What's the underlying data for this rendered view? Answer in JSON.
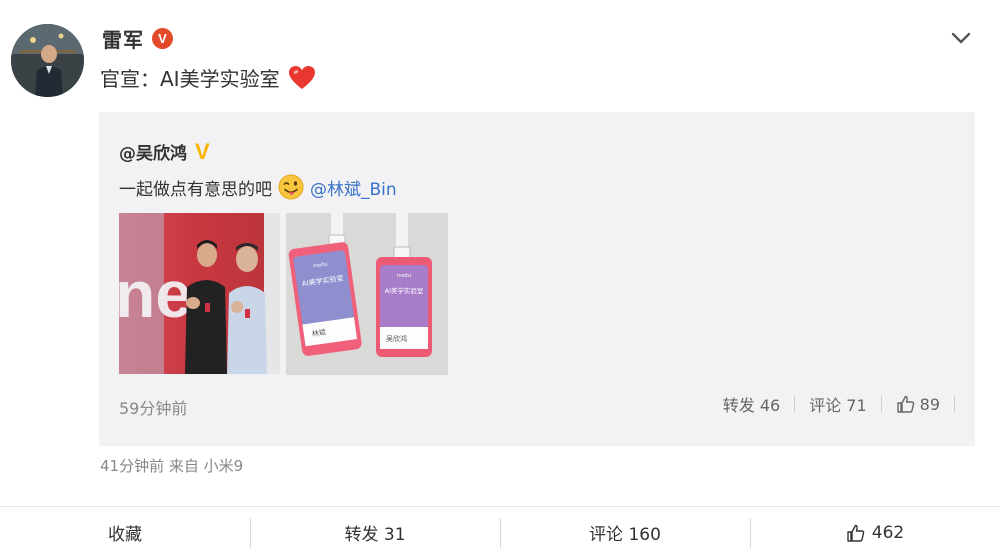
{
  "post": {
    "username": "雷军",
    "text": "官宣：AI美学实验室",
    "icons": {
      "badge": "verified-v-red",
      "menu": "chevron-down-icon",
      "emoji": "red-heart-icon"
    },
    "meta": "41分钟前 来自 小米9"
  },
  "repost": {
    "username": "@吴欣鸿",
    "text": "一起做点有意思的吧",
    "mention": "@林斌_Bin",
    "icons": {
      "badge": "verified-v-gold",
      "emoji": "tongue-wink-emoji"
    },
    "photo1": {
      "letters": "ne"
    },
    "photo2": {
      "badge1": {
        "brand": "meitu",
        "title": "AI美学实验室",
        "name": "林斌"
      },
      "badge2": {
        "brand": "meitu",
        "title": "AI美学实验室",
        "name": "吴欣鸿"
      }
    },
    "time": "59分钟前",
    "forward": "转发 46",
    "comment": "评论 71",
    "like": "89"
  },
  "bottom": {
    "collect": "收藏",
    "forward": "转发 31",
    "comment": "评论 160",
    "like": "462"
  },
  "colors": {
    "link": "#3972c8",
    "verified_red": "#e34a2a",
    "verified_gold": "#f7b500",
    "repost_bg": "#f2f2f5"
  }
}
